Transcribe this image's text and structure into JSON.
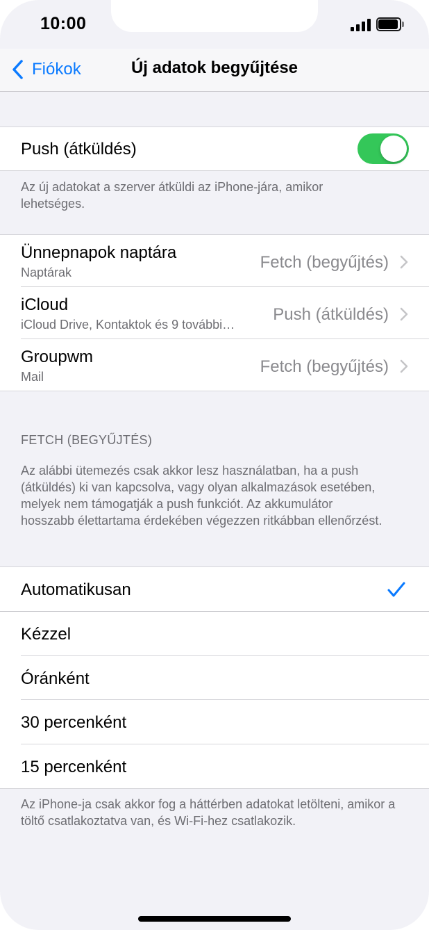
{
  "status_bar": {
    "time": "10:00"
  },
  "nav": {
    "back_label": "Fiókok",
    "title": "Új adatok begyűjtése"
  },
  "push_section": {
    "toggle_label": "Push (átküldés)",
    "toggle_on": true,
    "footer": "Az új adatokat a szerver átküldi az iPhone-jára, amikor lehetséges."
  },
  "accounts": [
    {
      "title": "Ünnepnapok naptára",
      "subtitle": "Naptárak",
      "value": "Fetch (begyűjtés)"
    },
    {
      "title": "iCloud",
      "subtitle": "iCloud Drive, Kontaktok és 9 további…",
      "value": "Push (átküldés)"
    },
    {
      "title": "Groupwm",
      "subtitle": "Mail",
      "value": "Fetch (begyűjtés)"
    }
  ],
  "fetch_section": {
    "header": "FETCH (BEGYŰJTÉS)",
    "description": "Az alábbi ütemezés csak akkor lesz használatban, ha a push (átküldés) ki van kapcsolva, vagy olyan alkalmazások esetében, melyek nem támogatják a push funkciót. Az akkumulátor hosszabb élettartama érdekében végezzen ritkábban ellenőrzést.",
    "options": [
      "Automatikusan",
      "Kézzel",
      "Óránként",
      "30 percenként",
      "15 percenként"
    ],
    "selected": "Automatikusan",
    "footer": "Az iPhone-ja csak akkor fog a háttérben adatokat letölteni, amikor a töltő csatlakoztatva van, és Wi-Fi-hez csatlakozik."
  },
  "colors": {
    "accent": "#0a7aff",
    "toggle_on": "#34c759",
    "background": "#f2f2f7",
    "secondary_text": "#6d6d72"
  },
  "icons": [
    "chevron-left-icon",
    "signal-icon",
    "battery-icon",
    "chevron-right-icon",
    "checkmark-icon"
  ]
}
